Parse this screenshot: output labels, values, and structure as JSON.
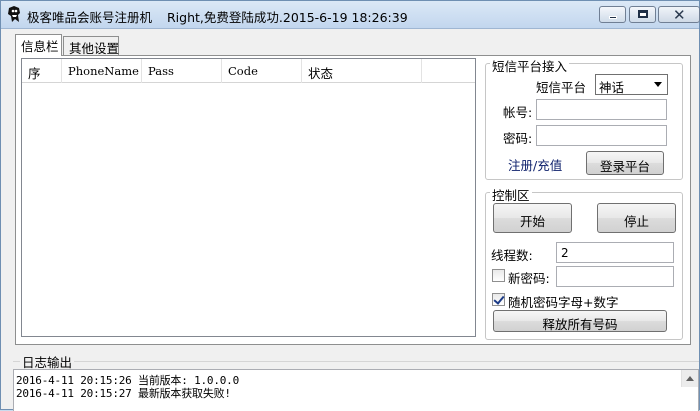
{
  "window": {
    "title": "极客唯品会账号注册机",
    "status_text": "Right,免费登陆成功.2015-6-19 18:26:39"
  },
  "tabs": [
    {
      "label": "信息栏",
      "active": true
    },
    {
      "label": "其他设置",
      "active": false
    }
  ],
  "list": {
    "columns": [
      "序",
      "PhoneName",
      "Pass",
      "Code",
      "状态"
    ],
    "rows": []
  },
  "sms_platform": {
    "group_title": "短信平台接入",
    "platform_label": "短信平台",
    "platform_value": "神话",
    "account_label": "帐号:",
    "account_value": "",
    "password_label": "密码:",
    "password_value": "",
    "register_link": "注册/充值",
    "login_button": "登录平台"
  },
  "control": {
    "group_title": "控制区",
    "start_button": "开始",
    "stop_button": "停止",
    "threads_label": "线程数:",
    "threads_value": "2",
    "new_password_label": "新密码:",
    "new_password_checked": false,
    "new_password_value": "",
    "random_password_label": "随机密码字母+数字",
    "random_password_checked": true,
    "release_button": "释放所有号码"
  },
  "log": {
    "title": "日志输出",
    "lines": [
      "2016-4-11 20:15:26 当前版本: 1.0.0.0",
      "2016-4-11 20:15:27 最新版本获取失败!"
    ]
  },
  "colors": {
    "titlebar": "#c2d6ee",
    "link": "#0c1f6b",
    "check": "#1c3b87"
  }
}
